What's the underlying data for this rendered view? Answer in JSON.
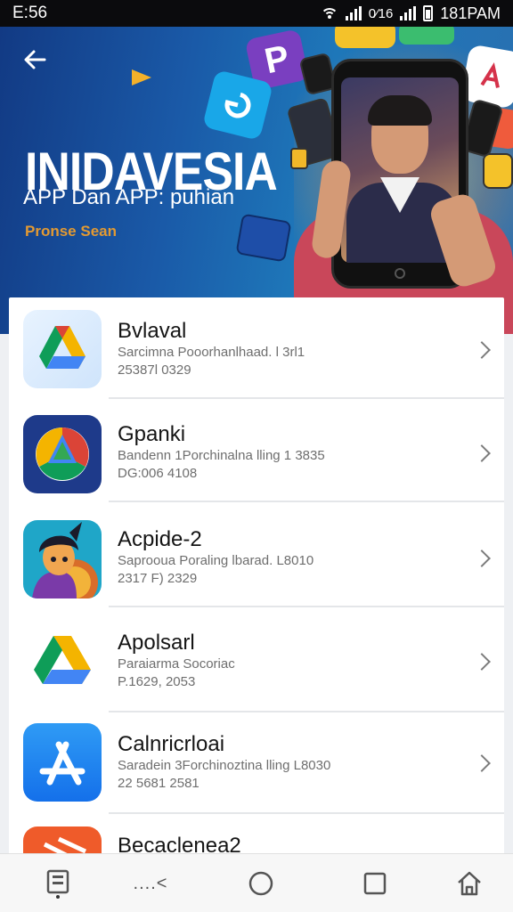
{
  "status_bar": {
    "time": "E:56",
    "network_label": "0⁄16",
    "right_time": "181PAM"
  },
  "banner": {
    "title": "INIDAVESIA",
    "subtitle": "APP Dan APP: puhian",
    "tagline": "Pronse Sean",
    "floating_icon_letter": "P",
    "accent_colors": [
      "#123a84",
      "#1e77b9",
      "#e39a32",
      "#c9475a"
    ]
  },
  "apps": [
    {
      "name": "Bvlaval",
      "desc": "Sarcimna Pooorhanlhaad. l 3rl1",
      "meta": "25387l 0329",
      "icon": "drive-triangle-icon"
    },
    {
      "name": "Gpanki",
      "desc": "Bandenn 1Porchinalna lling 1 3835",
      "meta": "DG:006 4108",
      "icon": "chrome-compass-icon"
    },
    {
      "name": "Acpide-2",
      "desc": "Saprooua Poraling lbarad. L8010",
      "meta": "2317 F) 2329",
      "icon": "avatar-character-icon"
    },
    {
      "name": "Apolsarl",
      "desc": "Paraiarma Socoriac",
      "meta": "P.1629, 2053",
      "icon": "drive-logo-icon"
    },
    {
      "name": "Calnricrloai",
      "desc": "Saradein 3Forchinoztina lling L8030",
      "meta": "22 5681 2581",
      "icon": "app-store-icon"
    },
    {
      "name": "Becaclenea2",
      "desc": "",
      "meta": "",
      "icon": "orange-app-icon"
    }
  ],
  "bottom_nav": {
    "items": [
      "save-icon",
      "share-icon",
      "home-circle-icon",
      "recent-square-icon",
      "house-icon"
    ],
    "share_dots": "....<"
  }
}
